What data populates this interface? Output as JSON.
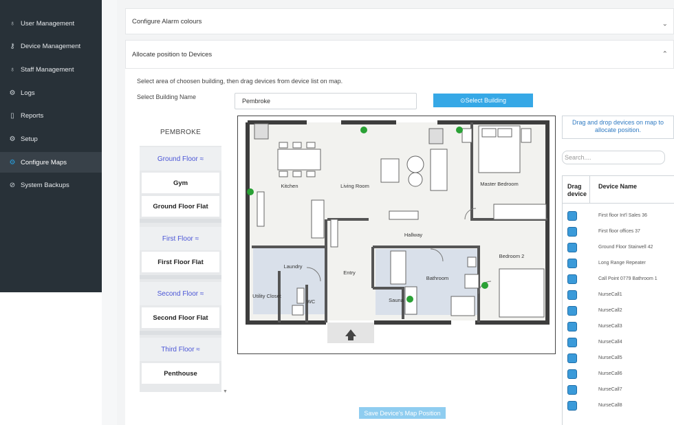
{
  "sidebar": {
    "items": [
      {
        "label": "User Management",
        "icon": "user-icon"
      },
      {
        "label": "Device Management",
        "icon": "key-icon"
      },
      {
        "label": "Staff Management",
        "icon": "users-icon"
      },
      {
        "label": "Logs",
        "icon": "settings-icon"
      },
      {
        "label": "Reports",
        "icon": "document-icon"
      },
      {
        "label": "Setup",
        "icon": "gear-icon"
      },
      {
        "label": "Configure Maps",
        "icon": "gear-icon",
        "active": true
      },
      {
        "label": "System Backups",
        "icon": "backup-icon"
      }
    ]
  },
  "panels": {
    "alarm_colours": "Configure Alarm colours",
    "allocate": "Allocate position to Devices"
  },
  "instructions": "Select area of choosen building, then drag devices from device list on map.",
  "select_building": {
    "label": "Select Building Name",
    "value": "Pembroke",
    "button": "⊙Select Building"
  },
  "floors": {
    "building": "PEMBROKE",
    "floors": [
      {
        "name": "Ground Floor ≈",
        "units": [
          "Gym",
          "Ground Floor Flat"
        ]
      },
      {
        "name": "First Floor ≈",
        "units": [
          "First Floor Flat"
        ]
      },
      {
        "name": "Second Floor ≈",
        "units": [
          "Second Floor Flat"
        ]
      },
      {
        "name": "Third Floor ≈",
        "units": [
          "Penthouse"
        ]
      }
    ]
  },
  "map": {
    "rooms": [
      "Kitchen",
      "Living Room",
      "Master Bedroom",
      "Hallway",
      "Laundry",
      "Entry",
      "Bathroom",
      "Bedroom 2",
      "Utility Closet",
      "WC",
      "Sauna"
    ]
  },
  "device_panel": {
    "drag_hint": "Drag and drop devices on map to allocate position.",
    "search_placeholder": "Search....",
    "col_drag": "Drag device",
    "col_name": "Device Name",
    "devices": [
      "First floor Int'l Sales 36",
      "First floor offices 37",
      "Ground Floor Stairwell 42",
      "Long Range Repeater",
      "Call Point 0779 Bathroom 1",
      "NurseCall1",
      "NurseCall2",
      "NurseCall3",
      "NurseCall4",
      "NurseCall5",
      "NurseCall6",
      "NurseCall7",
      "NurseCall8"
    ]
  },
  "save_button": "Save Device's Map Position",
  "colors": {
    "sidebar_bg": "#283138",
    "accent": "#36a8e6",
    "device_marker": "#2aa135",
    "floor_link": "#4a55d6"
  }
}
